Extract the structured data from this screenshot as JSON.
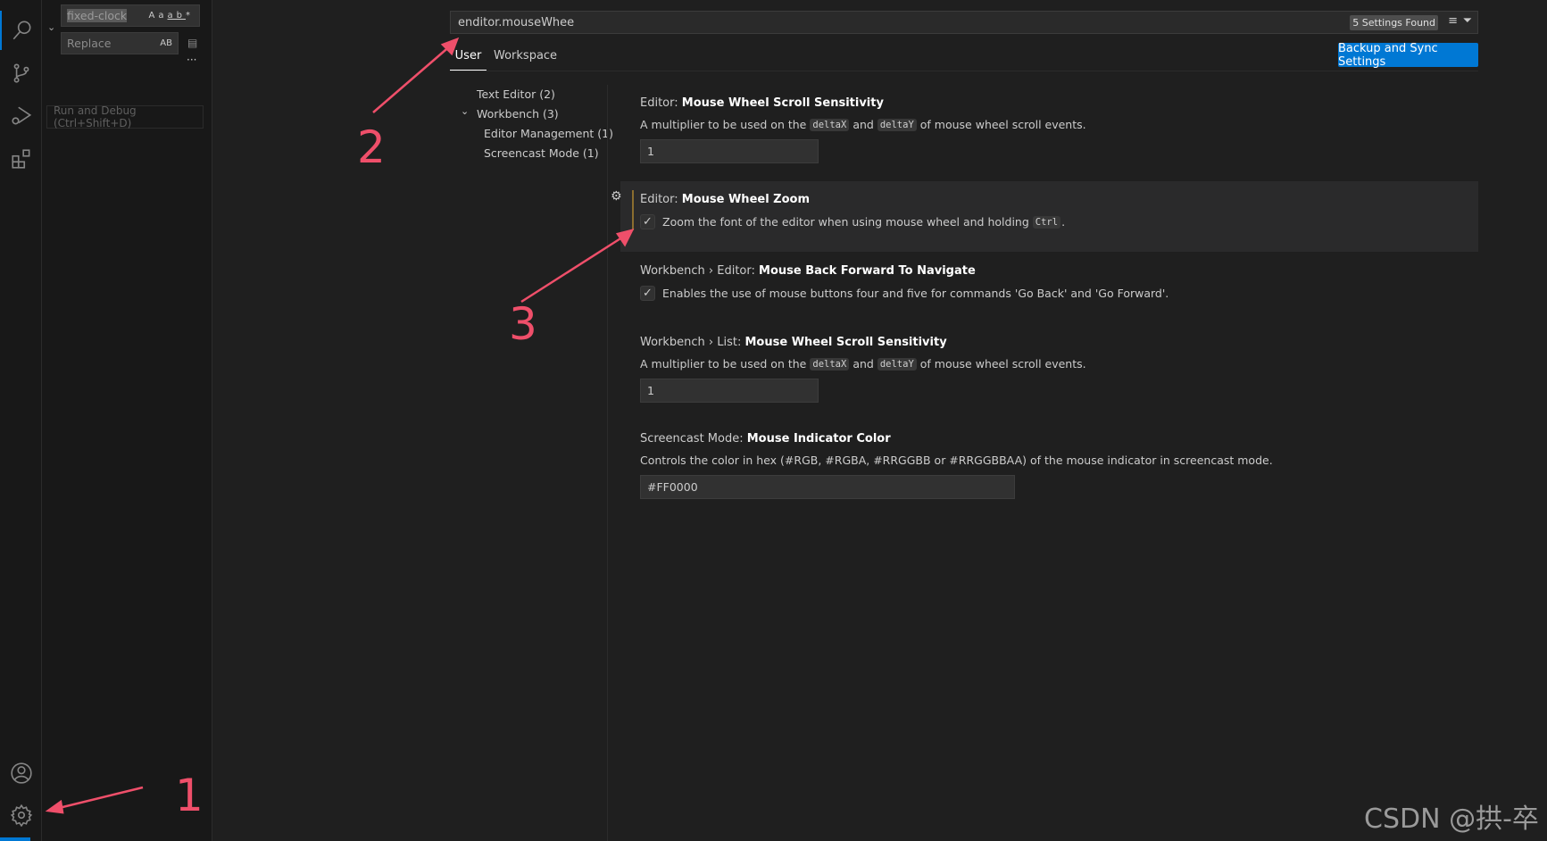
{
  "sidebar": {
    "find_value": "fixed-clock",
    "find_opts": [
      "Aa",
      "ab",
      "*"
    ],
    "replace_placeholder": "Replace",
    "replace_opt": "AB",
    "more": "···",
    "tooltip": "Run and Debug (Ctrl+Shift+D)"
  },
  "search": {
    "value": "enditor.mouseWhee",
    "found": "5 Settings Found"
  },
  "tabs": [
    "User",
    "Workspace"
  ],
  "backup_label": "Backup and Sync Settings",
  "toc": [
    "Text Editor (2)",
    "Workbench (3)",
    "Editor Management (1)",
    "Screencast Mode (1)"
  ],
  "settings": [
    {
      "prefix": "Editor: ",
      "name": "Mouse Wheel Scroll Sensitivity",
      "d1": "A multiplier to be used on the",
      "c1": "deltaX",
      "d2": "and",
      "c2": "deltaY",
      "d3": "of mouse wheel scroll events.",
      "value": "1"
    },
    {
      "prefix": "Editor: ",
      "name": "Mouse Wheel Zoom",
      "d1": "Zoom the font of the editor when using mouse wheel and holding",
      "c1": "Ctrl",
      "d2": ".",
      "checked": true
    },
    {
      "prefix": "Workbench › Editor: ",
      "name": "Mouse Back Forward To Navigate",
      "d1": "Enables the use of mouse buttons four and five for commands 'Go Back' and 'Go Forward'.",
      "checked": true
    },
    {
      "prefix": "Workbench › List: ",
      "name": "Mouse Wheel Scroll Sensitivity",
      "d1": "A multiplier to be used on the",
      "c1": "deltaX",
      "d2": "and",
      "c2": "deltaY",
      "d3": "of mouse wheel scroll events.",
      "value": "1"
    },
    {
      "prefix": "Screencast Mode: ",
      "name": "Mouse Indicator Color",
      "d1": "Controls the color in hex (#RGB, #RGBA, #RRGGBB or #RRGGBBAA) of the mouse indicator in screencast mode.",
      "value": "#FF0000"
    }
  ],
  "annotations": [
    "1",
    "2",
    "3"
  ],
  "watermark": "CSDN @拱-卒",
  "colors": {
    "accent": "#0078d4",
    "annotation": "#ef4f6a",
    "modified": "#8a6d2f"
  }
}
